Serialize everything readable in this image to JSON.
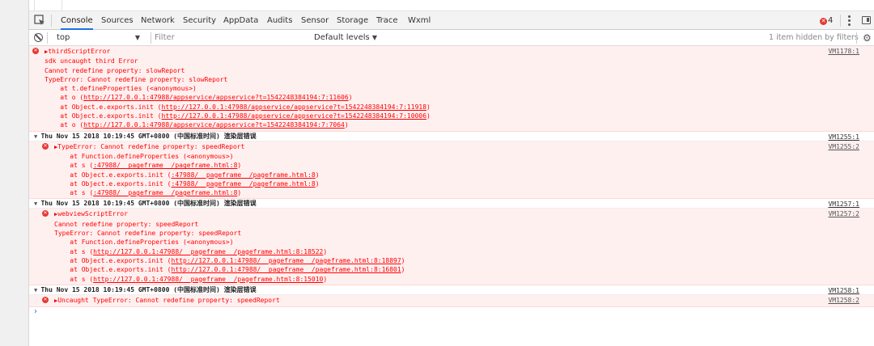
{
  "tabs": [
    "Console",
    "Sources",
    "Network",
    "Security",
    "AppData",
    "Audits",
    "Sensor",
    "Storage",
    "Trace",
    "Wxml"
  ],
  "active_tab": "Console",
  "error_count": "4",
  "context": "top",
  "filter_placeholder": "Filter",
  "levels_label": "Default levels",
  "hidden_label": "1 item hidden by filters",
  "entries": [
    {
      "kind": "error",
      "source": "VM1178:1",
      "lines": [
        {
          "t": "thirdScriptError"
        },
        {
          "t": "sdk uncaught third Error"
        },
        {
          "t": "Cannot redefine property: slowReport"
        },
        {
          "t": "TypeError: Cannot redefine property: slowReport"
        },
        {
          "t": "    at t.defineProperties (<anonymous>)"
        },
        {
          "t": "    at o (",
          "link": "http://127.0.0.1:47988/appservice/appservice?t=1542248384194:7:11606",
          "end": ")"
        },
        {
          "t": "    at Object.e.exports.init (",
          "link": "http://127.0.0.1:47988/appservice/appservice?t=1542248384194:7:11918",
          "end": ")"
        },
        {
          "t": "    at Object.e.exports.init (",
          "link": "http://127.0.0.1:47988/appservice/appservice?t=1542248384194:7:10006",
          "end": ")"
        },
        {
          "t": "    at o (",
          "link": "http://127.0.0.1:47988/appservice/appservice?t=1542248384194:7:7064",
          "end": ")"
        }
      ]
    },
    {
      "kind": "group",
      "source": "VM1255:1",
      "text": "Thu Nov 15 2018 10:19:45 GMT+0800 (中国标准时间) 渲染层错误"
    },
    {
      "kind": "error",
      "indent": true,
      "source": "VM1255:2",
      "lines": [
        {
          "t": "TypeError: Cannot redefine property: speedReport"
        },
        {
          "t": "    at Function.defineProperties (<anonymous>)"
        },
        {
          "t": "    at s (",
          "link": ":47988/__pageframe__/pageframe.html:8",
          "end": ")"
        },
        {
          "t": "    at Object.e.exports.init (",
          "link": ":47988/__pageframe__/pageframe.html:8",
          "end": ")"
        },
        {
          "t": "    at Object.e.exports.init (",
          "link": ":47988/__pageframe__/pageframe.html:8",
          "end": ")"
        },
        {
          "t": "    at s (",
          "link": ":47988/__pageframe__/pageframe.html:8",
          "end": ")"
        }
      ]
    },
    {
      "kind": "group",
      "source": "VM1257:1",
      "text": "Thu Nov 15 2018 10:19:45 GMT+0800 (中国标准时间) 渲染层错误"
    },
    {
      "kind": "error",
      "indent": true,
      "source": "VM1257:2",
      "lines": [
        {
          "t": "webviewScriptError"
        },
        {
          "t": "Cannot redefine property: speedReport"
        },
        {
          "t": "TypeError: Cannot redefine property: speedReport"
        },
        {
          "t": "    at Function.defineProperties (<anonymous>)"
        },
        {
          "t": "    at s (",
          "link": "http://127.0.0.1:47988/__pageframe__/pageframe.html:8:18522",
          "end": ")"
        },
        {
          "t": "    at Object.e.exports.init (",
          "link": "http://127.0.0.1:47988/__pageframe__/pageframe.html:8:18897",
          "end": ")"
        },
        {
          "t": "    at Object.e.exports.init (",
          "link": "http://127.0.0.1:47988/__pageframe__/pageframe.html:8:16801",
          "end": ")"
        },
        {
          "t": "    at s (",
          "link": "http://127.0.0.1:47988/__pageframe__/pageframe.html:8:15010",
          "end": ")"
        }
      ]
    },
    {
      "kind": "group",
      "source": "VM1258:1",
      "text": "Thu Nov 15 2018 10:19:45 GMT+0800 (中国标准时间) 渲染层错误"
    },
    {
      "kind": "error",
      "indent": true,
      "source": "VM1258:2",
      "lines": [
        {
          "t": "Uncaught TypeError: Cannot redefine property: speedReport"
        }
      ]
    }
  ],
  "prompt_symbol": "›"
}
